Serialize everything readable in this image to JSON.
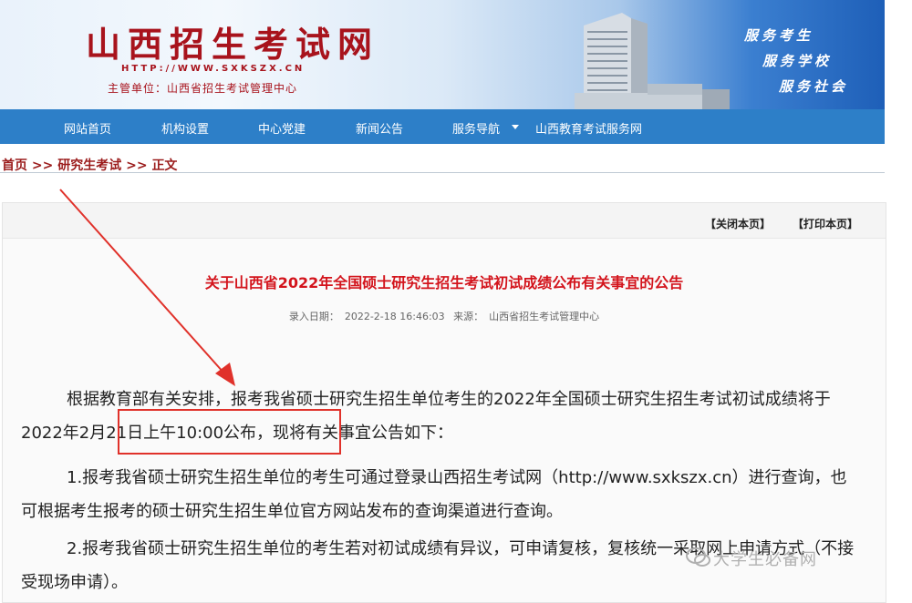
{
  "header": {
    "title": "山西招生考试网",
    "url": "HTTP://WWW.SXKSZX.CN",
    "sponsor": "主管单位：山西省招生考试管理中心",
    "slogans": [
      "服务考生",
      "服务学校",
      "服务社会"
    ]
  },
  "nav": {
    "items": [
      "网站首页",
      "机构设置",
      "中心党建",
      "新闻公告",
      "服务导航",
      "山西教育考试服务网"
    ]
  },
  "breadcrumb": {
    "home": "首页",
    "sep": ">>",
    "section": "研究生考试",
    "current": "正文"
  },
  "toolbar": {
    "close_label": "【关闭本页】",
    "print_label": "【打印本页】"
  },
  "article": {
    "title": "关于山西省2022年全国硕士研究生招生考试初试成绩公布有关事宜的公告",
    "date_label": "录入日期：",
    "date_value": "2022-2-18 16:46:03",
    "source_label": "来源：",
    "source_value": "山西省招生考试管理中心",
    "p1_before": "根据教育部有关安排，报考我省硕士研究生招生单位考生的2022年全国硕士研究生招生考试初试成绩将于",
    "p1_highlight": "2022年2月21日上午10:00",
    "p1_after": "公布，现将有关事宜公告如下：",
    "p2": "1.报考我省硕士研究生招生单位的考生可通过登录山西招生考试网（http://www.sxkszx.cn）进行查询，也可根据考生报考的硕士研究生招生单位官方网站发布的查询渠道进行查询。",
    "p3": "2.报考我省硕士研究生招生单位的考生若对初试成绩有异议，可申请复核，复核统一采取网上申请方式（不接受现场申请）。"
  },
  "watermark": "大学生必备网",
  "colors": {
    "nav_bg": "#2d7fc8",
    "brand_red": "#a8131c",
    "title_red": "#d3141c",
    "annotation_red": "#e0312a"
  }
}
